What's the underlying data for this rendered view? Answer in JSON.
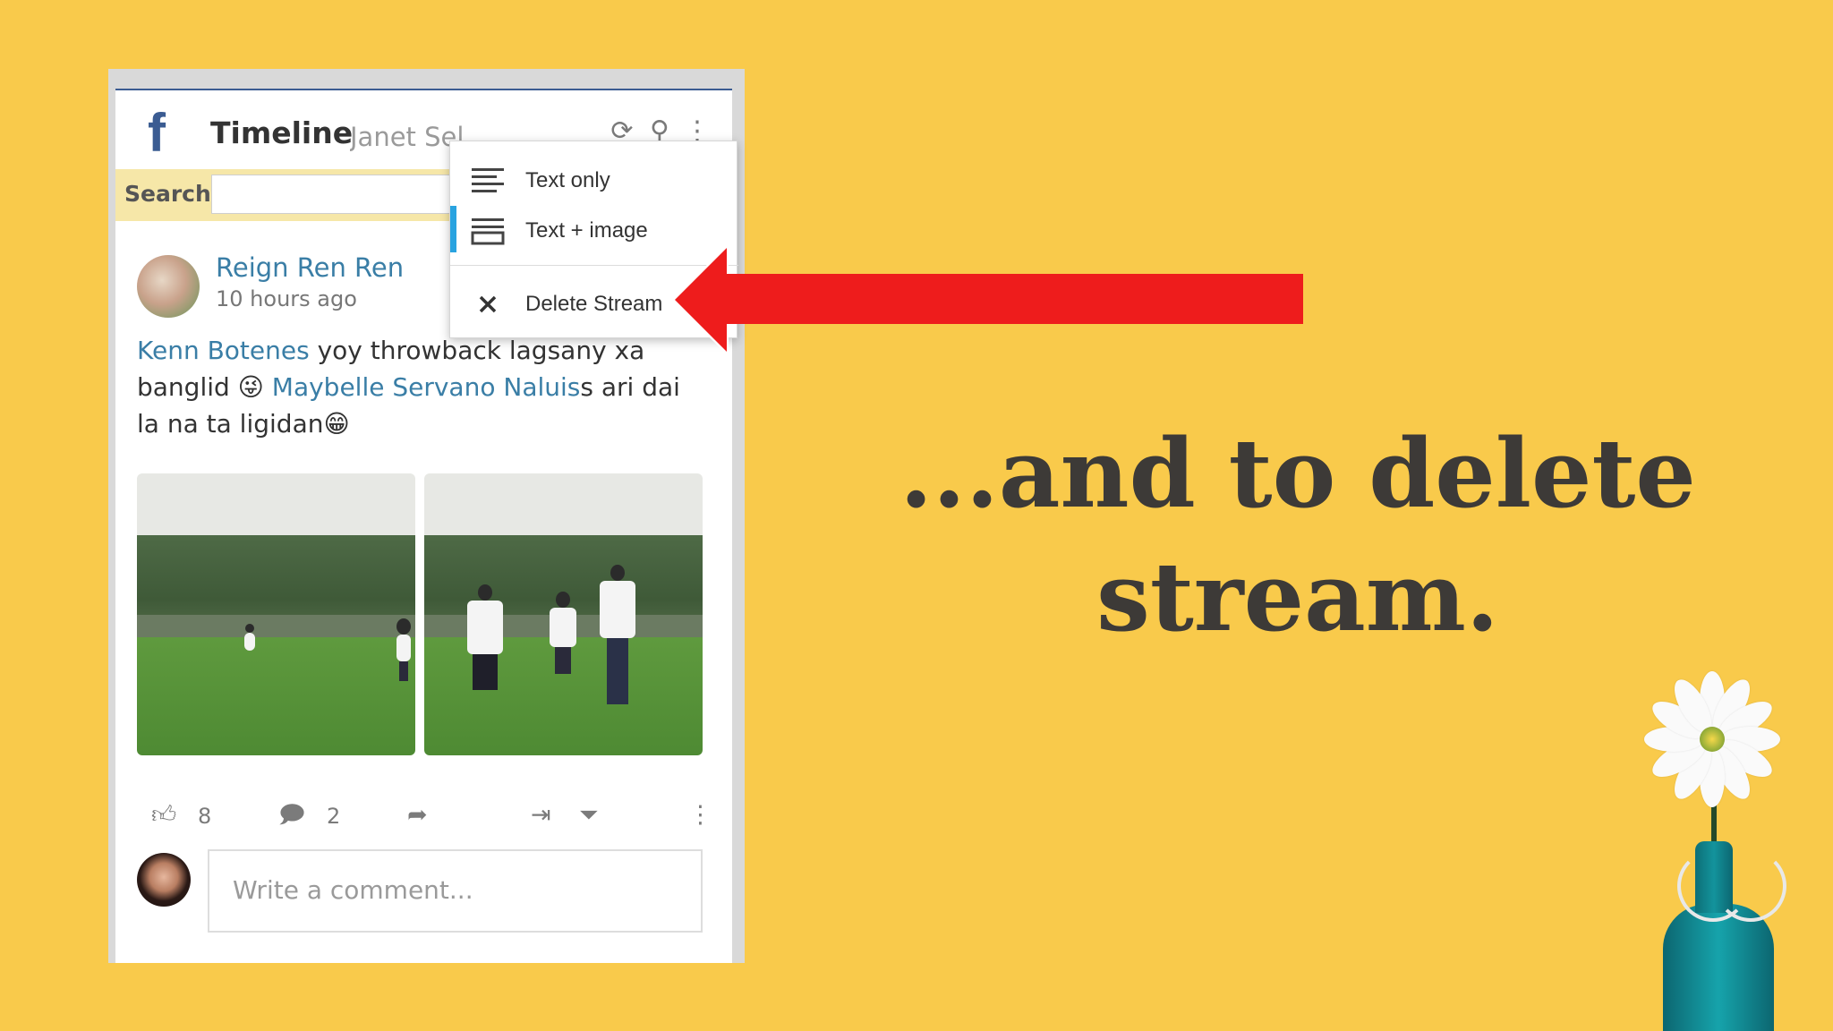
{
  "panel": {
    "header": {
      "title": "Timeline",
      "user": "Janet Selose",
      "icons": [
        "refresh-icon",
        "search-icon",
        "more-vertical-icon"
      ]
    },
    "search": {
      "label": "Search",
      "placeholder": ""
    },
    "post": {
      "author": "Reign Ren Ren",
      "time": "10 hours ago",
      "text_parts": [
        {
          "text": "Kenn Botenes",
          "mention": true
        },
        {
          "text": " yoy throwback lagsany xa banglid 😜 ",
          "mention": false
        },
        {
          "text": "Maybelle Servano Naluis",
          "mention": true
        },
        {
          "text": "s ari dai la na ta ligidan😁",
          "mention": false
        }
      ],
      "photo_count": 2
    },
    "actions": {
      "like_count": "8",
      "comment_count": "2"
    },
    "comment": {
      "placeholder": "Write a comment..."
    }
  },
  "menu": {
    "items": [
      {
        "label": "Text only",
        "icon": "text-only-icon"
      },
      {
        "label": "Text + image",
        "icon": "text-image-icon",
        "selected": true
      },
      {
        "label": "Delete Stream",
        "icon": "close-icon"
      }
    ]
  },
  "caption": {
    "line1": "...and to delete",
    "line2": "stream."
  },
  "colors": {
    "background": "#f9ca4b",
    "facebook_blue": "#3b5c92",
    "link": "#3a7ea6",
    "arrow": "#ee1c1c",
    "menu_selected": "#29a3e0"
  }
}
